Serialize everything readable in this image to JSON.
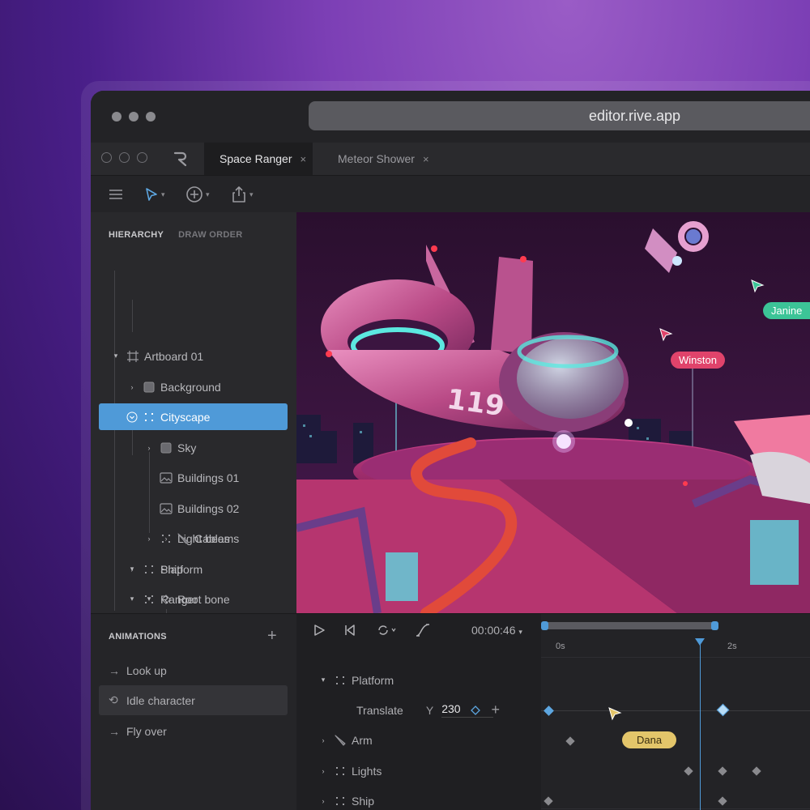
{
  "browser": {
    "url": "editor.rive.app"
  },
  "tabs": [
    {
      "label": "Space Ranger",
      "close": "×"
    },
    {
      "label": "Meteor Shower",
      "close": "×"
    }
  ],
  "hierarchy": {
    "tabs": {
      "active": "HIERARCHY",
      "inactive": "DRAW ORDER"
    },
    "items": [
      {
        "label": "Artboard 01"
      },
      {
        "label": "Background"
      },
      {
        "label": "Cityscape"
      },
      {
        "label": "Sky"
      },
      {
        "label": "Buildings 01"
      },
      {
        "label": "Buildings 02"
      },
      {
        "label": "Light beams"
      },
      {
        "label": "Platform"
      },
      {
        "label": "Root bone"
      },
      {
        "label": "Cables"
      },
      {
        "label": "Ship"
      },
      {
        "label": "Ranger"
      }
    ]
  },
  "canvas": {
    "ship_number": "119",
    "collaborators": [
      {
        "name": "Janine",
        "color": "#3cc497"
      },
      {
        "name": "Winston",
        "color": "#e0436b"
      }
    ]
  },
  "animations": {
    "title": "ANIMATIONS",
    "add": "+",
    "items": [
      {
        "label": "Look up",
        "icon": "arrow-right-icon"
      },
      {
        "label": "Idle character",
        "icon": "loop-icon"
      },
      {
        "label": "Fly over",
        "icon": "arrow-right-icon"
      }
    ]
  },
  "timeline": {
    "time": "00:00:46",
    "ticks": [
      "0s",
      "2s"
    ],
    "rows": [
      {
        "label": "Platform"
      },
      {
        "label": "Translate",
        "axis": "Y",
        "value": "230"
      },
      {
        "label": "Arm"
      },
      {
        "label": "Lights"
      },
      {
        "label": "Ship"
      }
    ],
    "collaborator": {
      "name": "Dana",
      "color": "#e3c56a"
    }
  }
}
